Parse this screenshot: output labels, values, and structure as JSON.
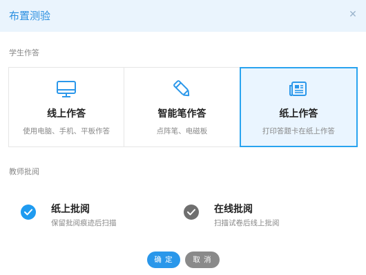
{
  "dialog": {
    "title": "布置测验",
    "close_icon": "close-icon"
  },
  "student_section": {
    "label": "学生作答",
    "modes": [
      {
        "title": "线上作答",
        "subtitle": "使用电脑、手机、平板作答",
        "icon": "monitor-icon",
        "selected": false
      },
      {
        "title": "智能笔作答",
        "subtitle": "点阵笔、电磁板",
        "icon": "pen-icon",
        "selected": false
      },
      {
        "title": "纸上作答",
        "subtitle": "打印答题卡在纸上作答",
        "icon": "paper-sheet-icon",
        "selected": true
      }
    ]
  },
  "teacher_section": {
    "label": "教师批阅",
    "options": [
      {
        "title": "纸上批阅",
        "subtitle": "保留批阅痕迹后扫描",
        "checked": true
      },
      {
        "title": "在线批阅",
        "subtitle": "扫描试卷后线上批阅",
        "checked": false
      }
    ]
  },
  "footer": {
    "ok_label": "确 定",
    "cancel_label": "取 消"
  },
  "colors": {
    "accent": "#2a97ea",
    "selected_border": "#28a3ef",
    "selected_bg": "#eaf5ff",
    "check_active": "#1f9bf0",
    "check_inactive": "#6f6f6f",
    "cancel_bg": "#8a8a8a"
  }
}
